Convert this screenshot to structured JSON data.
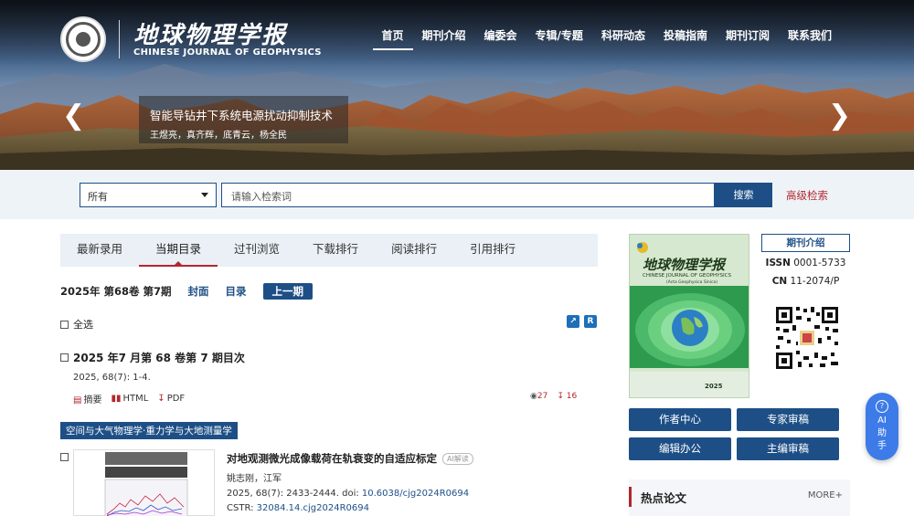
{
  "journal": {
    "title_cn": "地球物理学报",
    "title_en": "CHINESE JOURNAL OF GEOPHYSICS"
  },
  "nav": {
    "items": [
      {
        "label": "首页",
        "active": true
      },
      {
        "label": "期刊介绍"
      },
      {
        "label": "编委会"
      },
      {
        "label": "专辑/专题"
      },
      {
        "label": "科研动态"
      },
      {
        "label": "投稿指南"
      },
      {
        "label": "期刊订阅"
      },
      {
        "label": "联系我们"
      }
    ]
  },
  "slide": {
    "title": "智能导钻井下系统电源扰动抑制技术",
    "authors": "王煜亮，真齐辉，底青云，杨全民"
  },
  "search": {
    "scope": "所有",
    "placeholder": "请输入检索词",
    "button": "搜索",
    "advanced": "高级检索"
  },
  "tabs": [
    {
      "label": "最新录用"
    },
    {
      "label": "当期目录",
      "active": true
    },
    {
      "label": "过刊浏览"
    },
    {
      "label": "下载排行"
    },
    {
      "label": "阅读排行"
    },
    {
      "label": "引用排行"
    }
  ],
  "issue": {
    "label": "2025年 第68卷 第7期",
    "cover_link": "封面",
    "toc_link": "目录",
    "prev_button": "上一期"
  },
  "select_all": "全选",
  "toc_article": {
    "title": "2025 年7 月第 68 卷第 7 期目次",
    "cite": "2025, 68(7): 1-4.",
    "abstract": "摘要",
    "html": "HTML",
    "pdf": "PDF",
    "views": "27",
    "downloads": "16"
  },
  "section": "空间与大气物理学·重力学与大地测量学",
  "article": {
    "title": "对地观测微光成像载荷在轨衰变的自适应标定",
    "ai_badge": "AI解读",
    "authors": "姚志刚，江军",
    "cite_prefix": "2025, 68(7): 2433-2444. doi: ",
    "doi": "10.6038/cjg2024R0694",
    "cstr_prefix": "CSTR: ",
    "cstr": "32084.14.cjg2024R0694"
  },
  "sidebar": {
    "intro_button": "期刊介绍",
    "issn_label": "ISSN",
    "issn_value": "0001-5733",
    "cn_label": "CN",
    "cn_value": "11-2074/P",
    "buttons": [
      "作者中心",
      "专家审稿",
      "编辑办公",
      "主编审稿"
    ],
    "hot_title": "热点论文",
    "more": "MORE+",
    "cover_title": "地球物理学报",
    "cover_subtitle": "CHINESE JOURNAL OF GEOPHYSICS",
    "cover_subtitle2": "(Acta Geophysica Sinica)",
    "cover_year": "2025"
  },
  "ai_assistant": {
    "label_1": "AI",
    "label_2": "助",
    "label_3": "手"
  },
  "colors": {
    "primary": "#1d4f86",
    "accent_red": "#b3262e"
  }
}
